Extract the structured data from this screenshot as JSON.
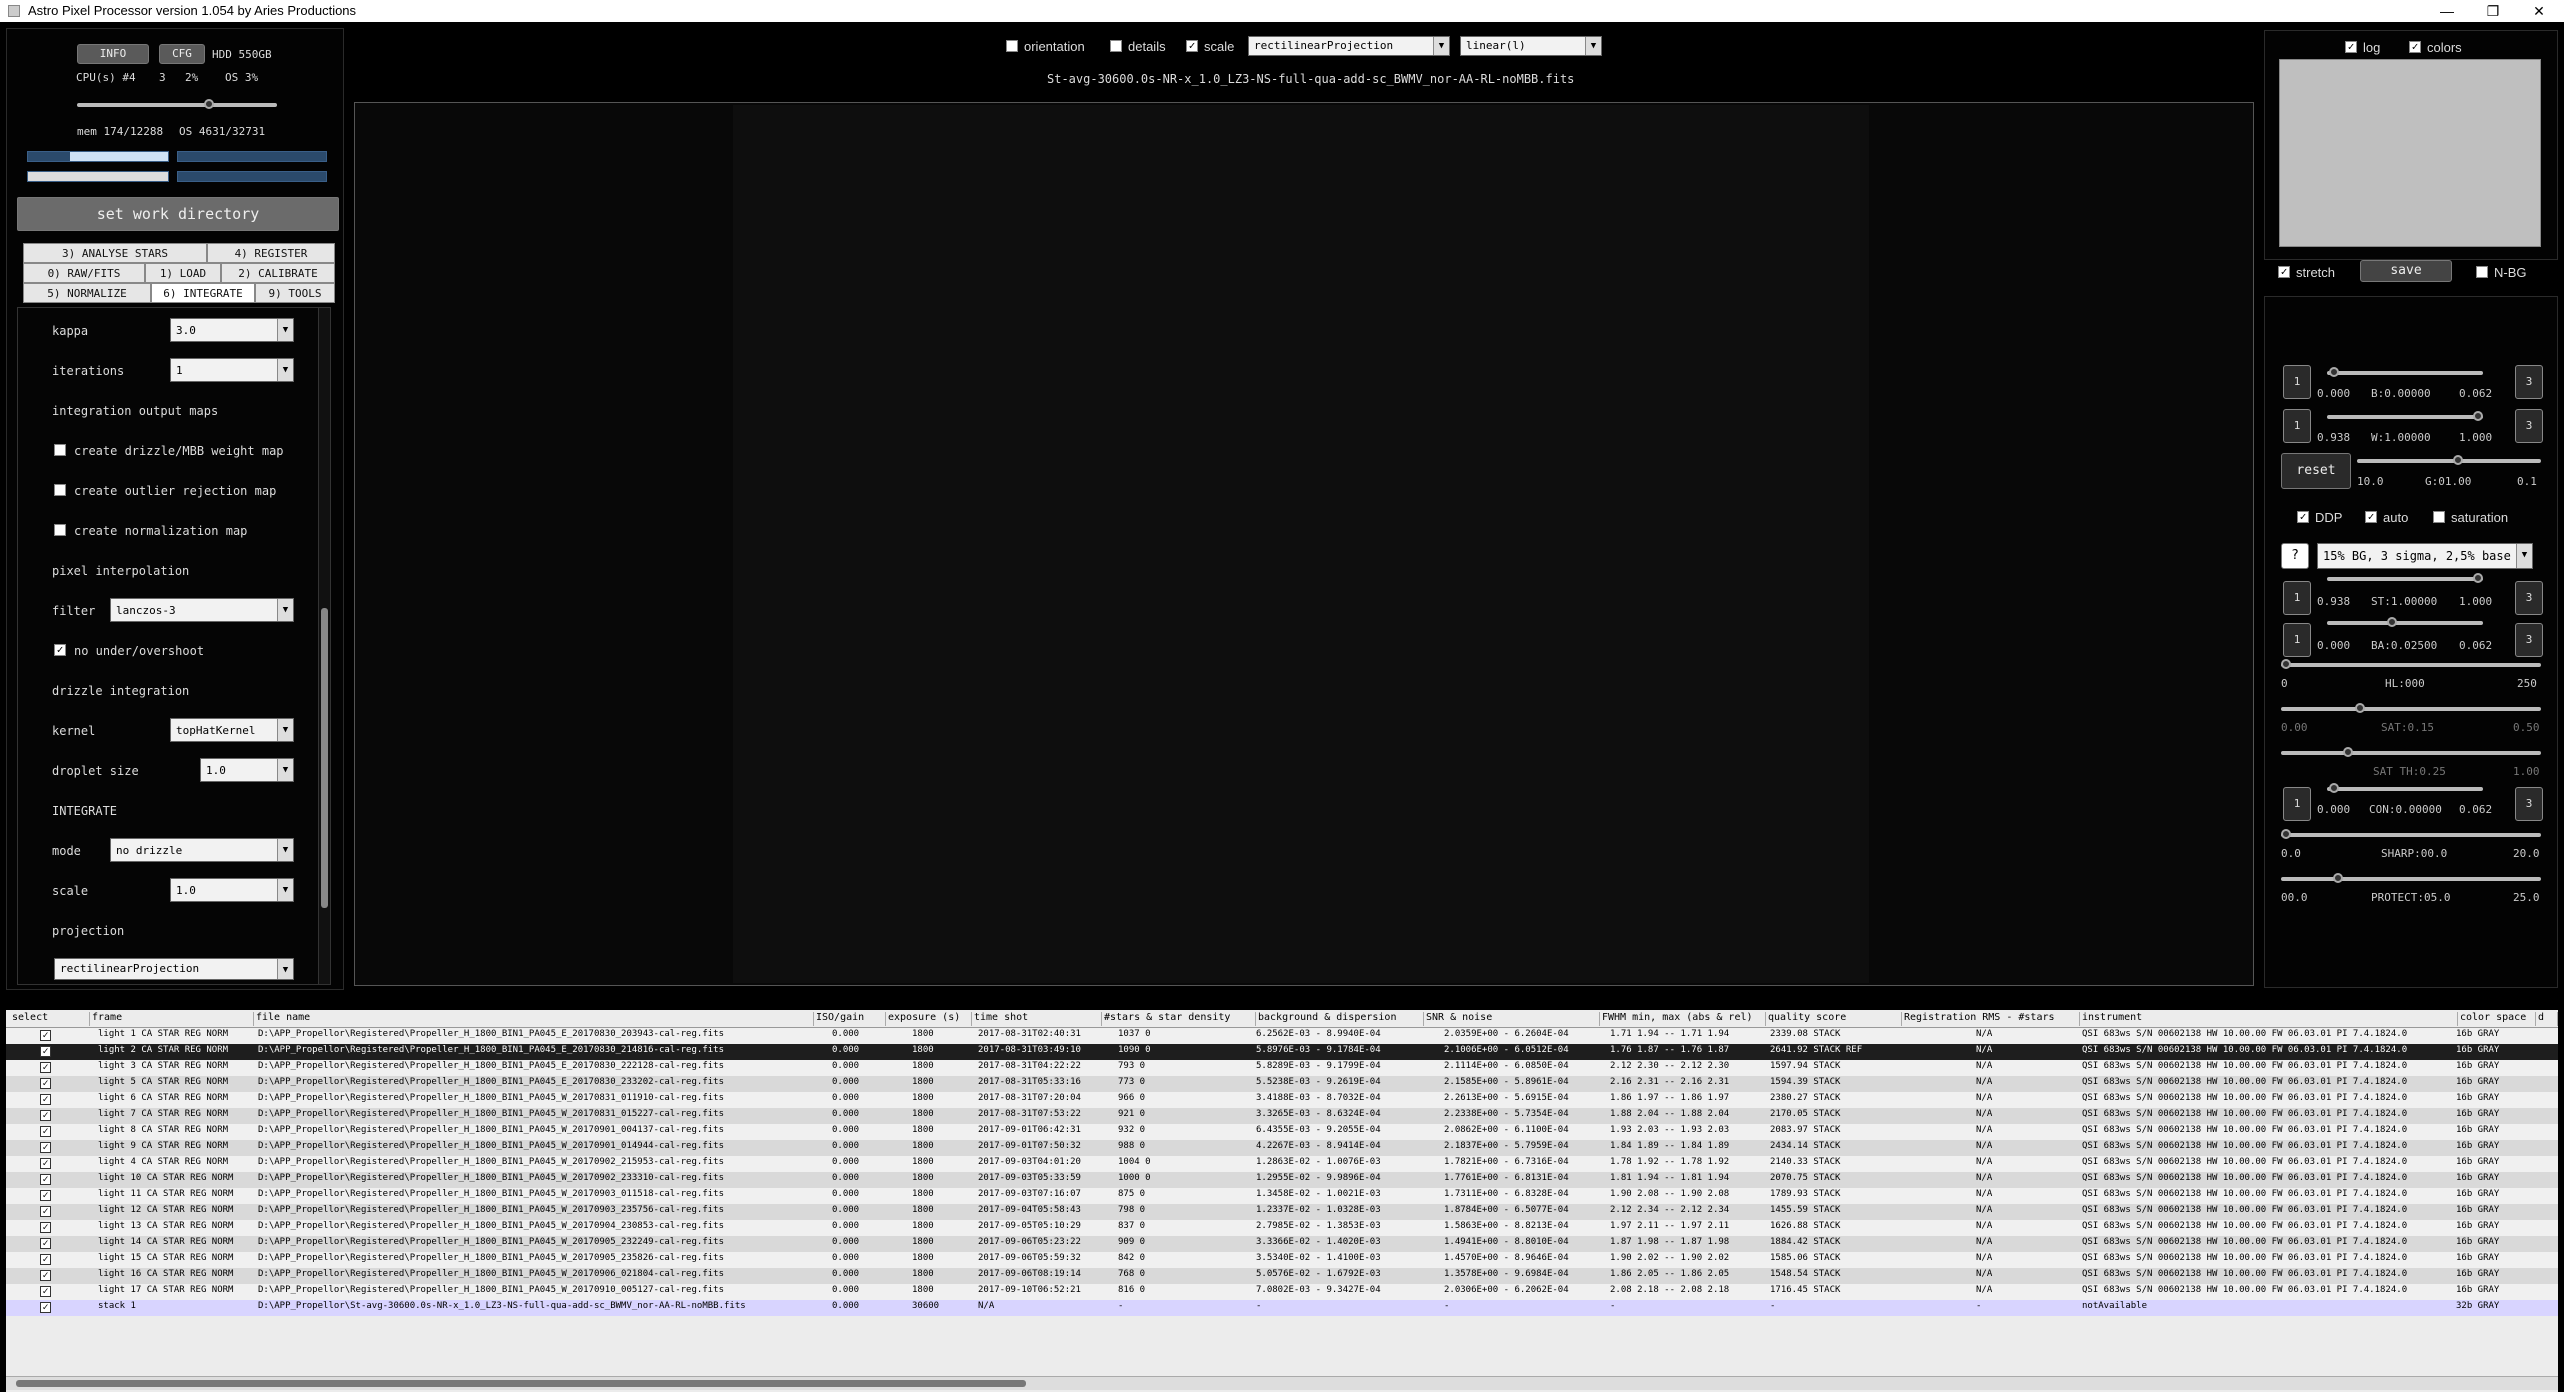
{
  "window": {
    "title": "Astro Pixel Processor version 1.054 by Aries Productions",
    "minimize": "—",
    "maximize": "❐",
    "close": "✕"
  },
  "left": {
    "info_btn": "INFO",
    "cfg_btn": "CFG",
    "hdd": "HDD 550GB",
    "cpu_label": "CPU(s) #4",
    "cpu_val1": "3",
    "cpu_val2": "2%",
    "os_label": "OS 3%",
    "mem_label": "mem 174/12288",
    "os_mem": "OS 4631/32731",
    "workdir_btn": "set work directory",
    "tabs": [
      "3) ANALYSE STARS",
      "4) REGISTER",
      "0) RAW/FITS",
      "1) LOAD",
      "2) CALIBRATE",
      "5) NORMALIZE",
      "6) INTEGRATE",
      "9) TOOLS"
    ],
    "kappa_label": "kappa",
    "kappa_value": "3.0",
    "iterations_label": "iterations",
    "iterations_value": "1",
    "output_maps_heading": "integration output maps",
    "cb_weight": "create drizzle/MBB weight map",
    "cb_outlier": "create outlier rejection map",
    "cb_norm": "create normalization map",
    "pixel_interp_heading": "pixel interpolation",
    "filter_label": "filter",
    "filter_value": "lanczos-3",
    "cb_undershoot": "no under/overshoot",
    "drizzle_heading": "drizzle integration",
    "kernel_label": "kernel",
    "kernel_value": "topHatKernel",
    "droplet_label": "droplet size",
    "droplet_value": "1.0",
    "integrate_heading": "INTEGRATE",
    "mode_label": "mode",
    "mode_value": "no drizzle",
    "scale_label": "scale",
    "scale_value": "1.0",
    "projection_label": "projection",
    "projection_value": "rectilinearProjection",
    "mem_bar_fraction": 0.7
  },
  "top": {
    "orientation": "orientation",
    "details": "details",
    "scale": "scale",
    "projection": "rectilinearProjection",
    "stretch_mode": "linear(l)",
    "filename": "St-avg-30600.0s-NR-x_1.0_LZ3-NS-full-qua-add-sc_BWMV_nor-AA-RL-noMBB.fits"
  },
  "right": {
    "log": "log",
    "colors": "colors",
    "stretch": "stretch",
    "save": "save",
    "nbg": "N-BG",
    "b_left": "0.000",
    "b_label": "B:0.00000",
    "b_right": "0.062",
    "w_left": "0.938",
    "w_label": "W:1.00000",
    "w_right": "1.000",
    "reset": "reset",
    "g_left": "10.0",
    "g_label": "G:01.00",
    "g_right": "0.1",
    "ddp": "DDP",
    "auto": "auto",
    "saturation": "saturation",
    "help": "?",
    "preset": "15% BG, 3 sigma, 2,5% base",
    "st_left": "0.938",
    "st_label": "ST:1.00000",
    "st_right": "1.000",
    "ba_left": "0.000",
    "ba_label": "BA:0.02500",
    "ba_right": "0.062",
    "hl_left": "0",
    "hl_label": "HL:000",
    "hl_right": "250",
    "sat_left": "0.00",
    "sat_label": "SAT:0.15",
    "sat_right": "0.50",
    "satth_label": "SAT TH:0.25",
    "satth_right": "1.00",
    "con_left": "0.000",
    "con_label": "CON:0.00000",
    "con_right": "0.062",
    "sharp_left": "0.0",
    "sharp_label": "SHARP:00.0",
    "sharp_right": "20.0",
    "protect_left": "00.0",
    "protect_label": "PROTECT:05.0",
    "protect_right": "25.0",
    "one": "1",
    "three": "3"
  },
  "table": {
    "headers": [
      "select",
      "frame",
      "file name",
      "ISO/gain",
      "exposure (s)",
      "time shot",
      "#stars & star density",
      "background & dispersion",
      "SNR & noise",
      "FWHM min, max (abs & rel)",
      "quality score",
      "Registration RMS - #stars",
      "instrument",
      "color space",
      "d"
    ],
    "rows": [
      [
        "light 1 CA STAR REG NORM",
        "D:\\APP_Propellor\\Registered\\Propeller_H_1800_BIN1_PA045_E_20170830_203943-cal-reg.fits",
        "0.000",
        "1800",
        "2017-08-31T02:40:31",
        "1037  0",
        "6.2562E-03 - 8.9940E-04",
        "2.0359E+00 - 6.2604E-04",
        "1.71 1.94 -- 1.71 1.94",
        "2339.08 STACK",
        "N/A",
        "QSI 683ws S/N 00602138 HW 10.00.00 FW 06.03.01 PI 7.4.1824.0",
        "16b GRAY"
      ],
      [
        "light 2 CA STAR REG NORM",
        "D:\\APP_Propellor\\Registered\\Propeller_H_1800_BIN1_PA045_E_20170830_214816-cal-reg.fits",
        "0.000",
        "1800",
        "2017-08-31T03:49:10",
        "1090  0",
        "5.8976E-03 - 9.1784E-04",
        "2.1006E+00 - 6.0512E-04",
        "1.76 1.87 -- 1.76 1.87",
        "2641.92 STACK REF",
        "N/A",
        "QSI 683ws S/N 00602138 HW 10.00.00 FW 06.03.01 PI 7.4.1824.0",
        "16b GRAY"
      ],
      [
        "light 3 CA STAR REG NORM",
        "D:\\APP_Propellor\\Registered\\Propeller_H_1800_BIN1_PA045_E_20170830_222128-cal-reg.fits",
        "0.000",
        "1800",
        "2017-08-31T04:22:22",
        "793  0",
        "5.8289E-03 - 9.1799E-04",
        "2.1114E+00 - 6.0850E-04",
        "2.12 2.30 -- 2.12 2.30",
        "1597.94 STACK",
        "N/A",
        "QSI 683ws S/N 00602138 HW 10.00.00 FW 06.03.01 PI 7.4.1824.0",
        "16b GRAY"
      ],
      [
        "light 5 CA STAR REG NORM",
        "D:\\APP_Propellor\\Registered\\Propeller_H_1800_BIN1_PA045_E_20170830_233202-cal-reg.fits",
        "0.000",
        "1800",
        "2017-08-31T05:33:16",
        "773  0",
        "5.5238E-03 - 9.2619E-04",
        "2.1585E+00 - 5.8961E-04",
        "2.16 2.31 -- 2.16 2.31",
        "1594.39 STACK",
        "N/A",
        "QSI 683ws S/N 00602138 HW 10.00.00 FW 06.03.01 PI 7.4.1824.0",
        "16b GRAY"
      ],
      [
        "light 6 CA STAR REG NORM",
        "D:\\APP_Propellor\\Registered\\Propeller_H_1800_BIN1_PA045_W_20170831_011910-cal-reg.fits",
        "0.000",
        "1800",
        "2017-08-31T07:20:04",
        "966  0",
        "3.4188E-03 - 8.7032E-04",
        "2.2613E+00 - 5.6915E-04",
        "1.86 1.97 -- 1.86 1.97",
        "2380.27 STACK",
        "N/A",
        "QSI 683ws S/N 00602138 HW 10.00.00 FW 06.03.01 PI 7.4.1824.0",
        "16b GRAY"
      ],
      [
        "light 7 CA STAR REG NORM",
        "D:\\APP_Propellor\\Registered\\Propeller_H_1800_BIN1_PA045_W_20170831_015227-cal-reg.fits",
        "0.000",
        "1800",
        "2017-08-31T07:53:22",
        "921  0",
        "3.3265E-03 - 8.6324E-04",
        "2.2338E+00 - 5.7354E-04",
        "1.88 2.04 -- 1.88 2.04",
        "2170.05 STACK",
        "N/A",
        "QSI 683ws S/N 00602138 HW 10.00.00 FW 06.03.01 PI 7.4.1824.0",
        "16b GRAY"
      ],
      [
        "light 8 CA STAR REG NORM",
        "D:\\APP_Propellor\\Registered\\Propeller_H_1800_BIN1_PA045_W_20170901_004137-cal-reg.fits",
        "0.000",
        "1800",
        "2017-09-01T06:42:31",
        "932  0",
        "6.4355E-03 - 9.2055E-04",
        "2.0862E+00 - 6.1100E-04",
        "1.93 2.03 -- 1.93 2.03",
        "2083.97 STACK",
        "N/A",
        "QSI 683ws S/N 00602138 HW 10.00.00 FW 06.03.01 PI 7.4.1824.0",
        "16b GRAY"
      ],
      [
        "light 9 CA STAR REG NORM",
        "D:\\APP_Propellor\\Registered\\Propeller_H_1800_BIN1_PA045_W_20170901_014944-cal-reg.fits",
        "0.000",
        "1800",
        "2017-09-01T07:50:32",
        "988  0",
        "4.2267E-03 - 8.9414E-04",
        "2.1837E+00 - 5.7959E-04",
        "1.84 1.89 -- 1.84 1.89",
        "2434.14 STACK",
        "N/A",
        "QSI 683ws S/N 00602138 HW 10.00.00 FW 06.03.01 PI 7.4.1824.0",
        "16b GRAY"
      ],
      [
        "light 4 CA STAR REG NORM",
        "D:\\APP_Propellor\\Registered\\Propeller_H_1800_BIN1_PA045_W_20170902_215953-cal-reg.fits",
        "0.000",
        "1800",
        "2017-09-03T04:01:20",
        "1004  0",
        "1.2863E-02 - 1.0076E-03",
        "1.7821E+00 - 6.7316E-04",
        "1.78 1.92 -- 1.78 1.92",
        "2140.33 STACK",
        "N/A",
        "QSI 683ws S/N 00602138 HW 10.00.00 FW 06.03.01 PI 7.4.1824.0",
        "16b GRAY"
      ],
      [
        "light 10 CA STAR REG NORM",
        "D:\\APP_Propellor\\Registered\\Propeller_H_1800_BIN1_PA045_W_20170902_233310-cal-reg.fits",
        "0.000",
        "1800",
        "2017-09-03T05:33:59",
        "1000  0",
        "1.2955E-02 - 9.9896E-04",
        "1.7761E+00 - 6.8131E-04",
        "1.81 1.94 -- 1.81 1.94",
        "2070.75 STACK",
        "N/A",
        "QSI 683ws S/N 00602138 HW 10.00.00 FW 06.03.01 PI 7.4.1824.0",
        "16b GRAY"
      ],
      [
        "light 11 CA STAR REG NORM",
        "D:\\APP_Propellor\\Registered\\Propeller_H_1800_BIN1_PA045_W_20170903_011518-cal-reg.fits",
        "0.000",
        "1800",
        "2017-09-03T07:16:07",
        "875  0",
        "1.3458E-02 - 1.0021E-03",
        "1.7311E+00 - 6.8328E-04",
        "1.90 2.08 -- 1.90 2.08",
        "1789.93 STACK",
        "N/A",
        "QSI 683ws S/N 00602138 HW 10.00.00 FW 06.03.01 PI 7.4.1824.0",
        "16b GRAY"
      ],
      [
        "light 12 CA STAR REG NORM",
        "D:\\APP_Propellor\\Registered\\Propeller_H_1800_BIN1_PA045_W_20170903_235756-cal-reg.fits",
        "0.000",
        "1800",
        "2017-09-04T05:58:43",
        "798  0",
        "1.2337E-02 - 1.0328E-03",
        "1.8784E+00 - 6.5077E-04",
        "2.12 2.34 -- 2.12 2.34",
        "1455.59 STACK",
        "N/A",
        "QSI 683ws S/N 00602138 HW 10.00.00 FW 06.03.01 PI 7.4.1824.0",
        "16b GRAY"
      ],
      [
        "light 13 CA STAR REG NORM",
        "D:\\APP_Propellor\\Registered\\Propeller_H_1800_BIN1_PA045_W_20170904_230853-cal-reg.fits",
        "0.000",
        "1800",
        "2017-09-05T05:10:29",
        "837  0",
        "2.7985E-02 - 1.3853E-03",
        "1.5863E+00 - 8.8213E-04",
        "1.97 2.11 -- 1.97 2.11",
        "1626.88 STACK",
        "N/A",
        "QSI 683ws S/N 00602138 HW 10.00.00 FW 06.03.01 PI 7.4.1824.0",
        "16b GRAY"
      ],
      [
        "light 14 CA STAR REG NORM",
        "D:\\APP_Propellor\\Registered\\Propeller_H_1800_BIN1_PA045_W_20170905_232249-cal-reg.fits",
        "0.000",
        "1800",
        "2017-09-06T05:23:22",
        "909  0",
        "3.3366E-02 - 1.4020E-03",
        "1.4941E+00 - 8.8010E-04",
        "1.87 1.98 -- 1.87 1.98",
        "1884.42 STACK",
        "N/A",
        "QSI 683ws S/N 00602138 HW 10.00.00 FW 06.03.01 PI 7.4.1824.0",
        "16b GRAY"
      ],
      [
        "light 15 CA STAR REG NORM",
        "D:\\APP_Propellor\\Registered\\Propeller_H_1800_BIN1_PA045_W_20170905_235826-cal-reg.fits",
        "0.000",
        "1800",
        "2017-09-06T05:59:32",
        "842  0",
        "3.5340E-02 - 1.4100E-03",
        "1.4570E+00 - 8.9646E-04",
        "1.90 2.02 -- 1.90 2.02",
        "1585.06 STACK",
        "N/A",
        "QSI 683ws S/N 00602138 HW 10.00.00 FW 06.03.01 PI 7.4.1824.0",
        "16b GRAY"
      ],
      [
        "light 16 CA STAR REG NORM",
        "D:\\APP_Propellor\\Registered\\Propeller_H_1800_BIN1_PA045_W_20170906_021804-cal-reg.fits",
        "0.000",
        "1800",
        "2017-09-06T08:19:14",
        "768  0",
        "5.0576E-02 - 1.6792E-03",
        "1.3578E+00 - 9.6984E-04",
        "1.86 2.05 -- 1.86 2.05",
        "1548.54 STACK",
        "N/A",
        "QSI 683ws S/N 00602138 HW 10.00.00 FW 06.03.01 PI 7.4.1824.0",
        "16b GRAY"
      ],
      [
        "light 17 CA STAR REG NORM",
        "D:\\APP_Propellor\\Registered\\Propeller_H_1800_BIN1_PA045_W_20170910_005127-cal-reg.fits",
        "0.000",
        "1800",
        "2017-09-10T06:52:21",
        "816  0",
        "7.0802E-03 - 9.3427E-04",
        "2.0306E+00 - 6.2062E-04",
        "2.08 2.18 -- 2.08 2.18",
        "1716.45 STACK",
        "N/A",
        "QSI 683ws S/N 00602138 HW 10.00.00 FW 06.03.01 PI 7.4.1824.0",
        "16b GRAY"
      ],
      [
        "stack 1",
        "D:\\APP_Propellor\\St-avg-30600.0s-NR-x_1.0_LZ3-NS-full-qua-add-sc_BWMV_nor-AA-RL-noMBB.fits",
        "0.000",
        "30600",
        "N/A",
        "-",
        "-",
        "-",
        "-",
        "-",
        "-",
        "notAvailable",
        "32b GRAY"
      ]
    ]
  }
}
